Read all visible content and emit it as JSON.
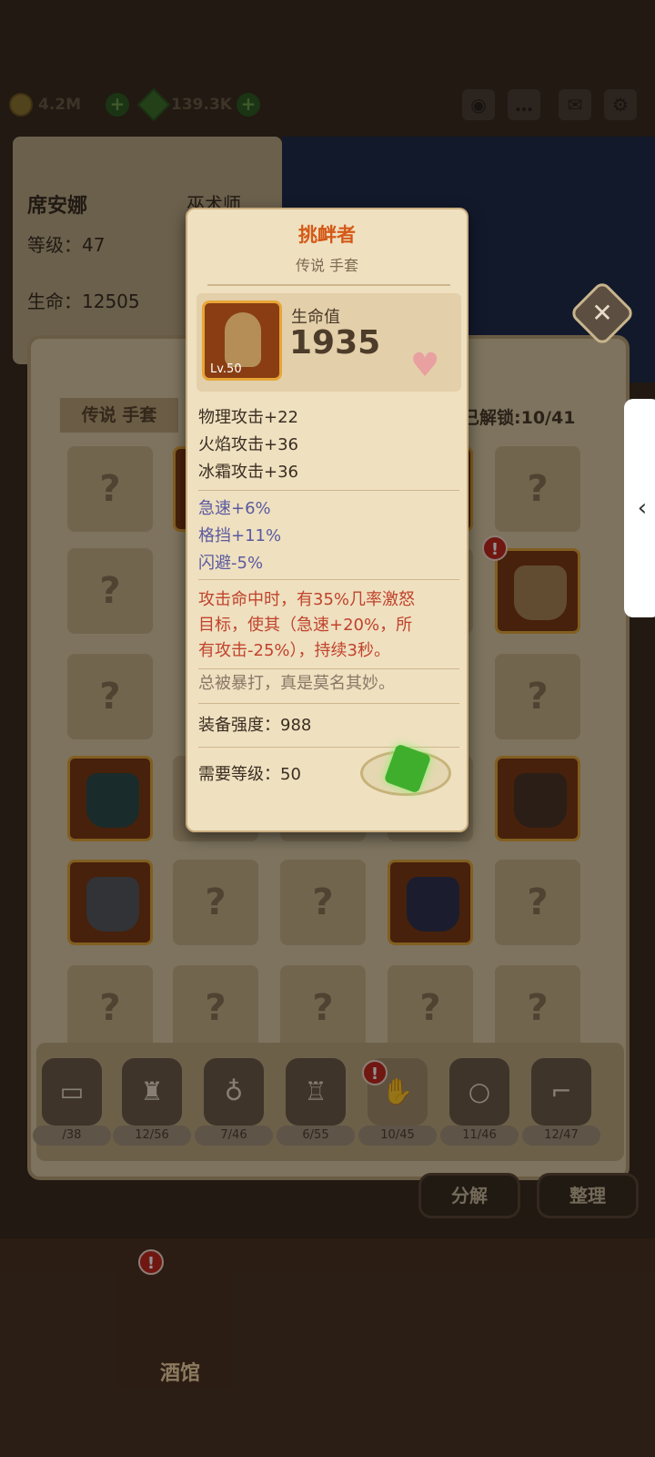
{
  "topbar": {
    "gold": "4.2M",
    "gems": "139.3K"
  },
  "hero": {
    "name": "席安娜",
    "class": "巫术师",
    "level": "等级：47",
    "hp": "生命：12505"
  },
  "collection": {
    "title": "传说 手套",
    "unlocked": "已解锁:10/41",
    "unknown_mark": "?"
  },
  "categories": [
    {
      "icon": "boot-icon",
      "count": "/38"
    },
    {
      "icon": "armor-icon",
      "count": "12/56"
    },
    {
      "icon": "necklace-icon",
      "count": "7/46"
    },
    {
      "icon": "shirt-icon",
      "count": "6/55"
    },
    {
      "icon": "glove-icon",
      "count": "10/45"
    },
    {
      "icon": "ring-icon",
      "count": "11/46"
    },
    {
      "icon": "boots-icon",
      "count": "12/47"
    }
  ],
  "buttons": {
    "decompose": "分解",
    "organize": "整理"
  },
  "bottom_nav": {
    "tavern": "酒馆"
  },
  "alert_mark": "!",
  "popup": {
    "name": "挑衅者",
    "subtitle": "传说 手套",
    "level_badge": "Lv.50",
    "main_stat_label": "生命值",
    "main_stat_value": "1935",
    "base_stats": [
      "物理攻击+22",
      "火焰攻击+36",
      "冰霜攻击+36"
    ],
    "bonus_stats": [
      "急速+6%",
      "格挡+11%",
      "闪避-5%"
    ],
    "effect_lines": [
      "攻击命中时，有35%几率激怒",
      "目标，使其（急速+20%，所",
      "有攻击-25%），持续3秒。"
    ],
    "flavor": "总被暴打，真是莫名其妙。",
    "power": "装备强度：988",
    "required_level": "需要等级：50",
    "close": "✕"
  },
  "colors": {
    "title_orange": "#d45a18",
    "bonus_blue": "#5a5aa0",
    "effect_red": "#c0432c",
    "parchment": "#efe0c0"
  }
}
